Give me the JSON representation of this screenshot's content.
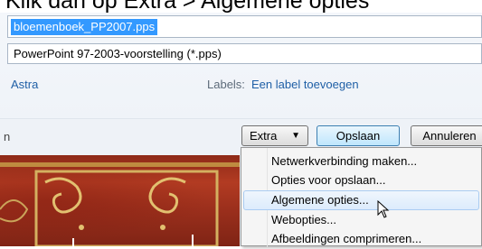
{
  "caption": "Klik dan op Extra > Algemene opties",
  "dialog": {
    "filename": "bloemenboek_PP2007.pps",
    "filetype": "PowerPoint 97-2003-voorstelling (*.pps)",
    "author": "Astra",
    "labels_title": "Labels:",
    "labels_link": "Een label toevoegen",
    "left_fragment": "n"
  },
  "buttons": {
    "extra": "Extra",
    "extra_arrow": "▼",
    "save": "Opslaan",
    "cancel": "Annuleren"
  },
  "menu": {
    "items": [
      {
        "label": "Netwerkverbinding maken..."
      },
      {
        "label": "Opties voor opslaan..."
      },
      {
        "label": "Algemene opties..."
      },
      {
        "label": "Webopties..."
      },
      {
        "label": "Afbeeldingen comprimeren..."
      }
    ]
  }
}
